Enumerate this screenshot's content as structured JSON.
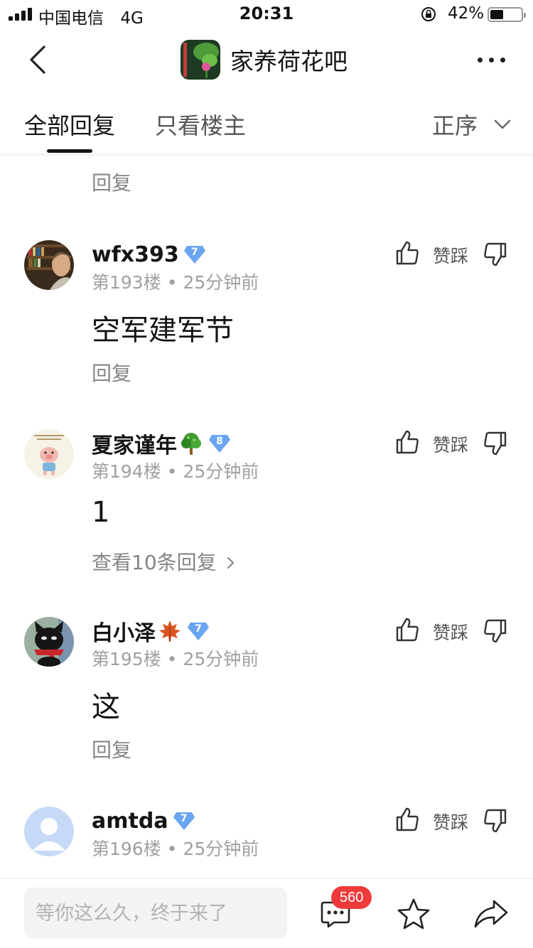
{
  "status_bar": {
    "carrier": "中国电信",
    "network": "4G",
    "time": "20:31",
    "battery_percent": "42%"
  },
  "nav": {
    "forum_name": "家养荷花吧",
    "back_icon": "chevron-left-icon",
    "more_icon": "more-dots-icon"
  },
  "tabs": {
    "all_replies": "全部回复",
    "owner_only": "只看楼主",
    "sort_label": "正序"
  },
  "top_reply_label": "回复",
  "posts": [
    {
      "username": "wfx393",
      "level": "7",
      "floor": "第193楼",
      "time": "25分钟前",
      "content": "空军建军节",
      "reply_label": "回复",
      "vote_label": "赞踩",
      "avatar": "bookshelf-photo"
    },
    {
      "username": "夏家谨年",
      "emoji": "tree-emoji",
      "level": "8",
      "floor": "第194楼",
      "time": "25分钟前",
      "content": "1",
      "reply_label": "查看10条回复",
      "vote_label": "赞踩",
      "avatar": "cartoon-pig"
    },
    {
      "username": "白小泽",
      "emoji": "maple-leaf-emoji",
      "level": "7",
      "floor": "第195楼",
      "time": "25分钟前",
      "content": "这",
      "reply_label": "回复",
      "vote_label": "赞踩",
      "avatar": "black-cat-plush"
    },
    {
      "username": "amtda",
      "level": "7",
      "floor": "第196楼",
      "time": "25分钟前",
      "vote_label": "赞踩",
      "avatar": "default-avatar"
    }
  ],
  "bottom_bar": {
    "input_placeholder": "等你这么久，终于来了",
    "comment_count": "560"
  },
  "colors": {
    "text_primary": "#141414",
    "text_secondary": "#858585",
    "badge_blue": "#6aa5f0",
    "count_red": "#ef3a3a"
  }
}
